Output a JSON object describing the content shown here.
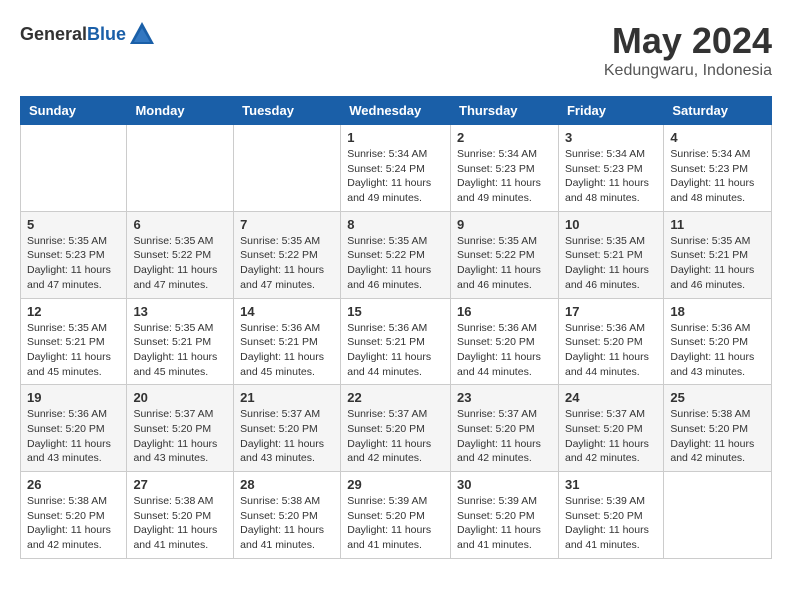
{
  "header": {
    "logo_general": "General",
    "logo_blue": "Blue",
    "title": "May 2024",
    "subtitle": "Kedungwaru, Indonesia"
  },
  "weekdays": [
    "Sunday",
    "Monday",
    "Tuesday",
    "Wednesday",
    "Thursday",
    "Friday",
    "Saturday"
  ],
  "weeks": [
    [
      {
        "day": "",
        "info": ""
      },
      {
        "day": "",
        "info": ""
      },
      {
        "day": "",
        "info": ""
      },
      {
        "day": "1",
        "info": "Sunrise: 5:34 AM\nSunset: 5:24 PM\nDaylight: 11 hours\nand 49 minutes."
      },
      {
        "day": "2",
        "info": "Sunrise: 5:34 AM\nSunset: 5:23 PM\nDaylight: 11 hours\nand 49 minutes."
      },
      {
        "day": "3",
        "info": "Sunrise: 5:34 AM\nSunset: 5:23 PM\nDaylight: 11 hours\nand 48 minutes."
      },
      {
        "day": "4",
        "info": "Sunrise: 5:34 AM\nSunset: 5:23 PM\nDaylight: 11 hours\nand 48 minutes."
      }
    ],
    [
      {
        "day": "5",
        "info": "Sunrise: 5:35 AM\nSunset: 5:23 PM\nDaylight: 11 hours\nand 47 minutes."
      },
      {
        "day": "6",
        "info": "Sunrise: 5:35 AM\nSunset: 5:22 PM\nDaylight: 11 hours\nand 47 minutes."
      },
      {
        "day": "7",
        "info": "Sunrise: 5:35 AM\nSunset: 5:22 PM\nDaylight: 11 hours\nand 47 minutes."
      },
      {
        "day": "8",
        "info": "Sunrise: 5:35 AM\nSunset: 5:22 PM\nDaylight: 11 hours\nand 46 minutes."
      },
      {
        "day": "9",
        "info": "Sunrise: 5:35 AM\nSunset: 5:22 PM\nDaylight: 11 hours\nand 46 minutes."
      },
      {
        "day": "10",
        "info": "Sunrise: 5:35 AM\nSunset: 5:21 PM\nDaylight: 11 hours\nand 46 minutes."
      },
      {
        "day": "11",
        "info": "Sunrise: 5:35 AM\nSunset: 5:21 PM\nDaylight: 11 hours\nand 46 minutes."
      }
    ],
    [
      {
        "day": "12",
        "info": "Sunrise: 5:35 AM\nSunset: 5:21 PM\nDaylight: 11 hours\nand 45 minutes."
      },
      {
        "day": "13",
        "info": "Sunrise: 5:35 AM\nSunset: 5:21 PM\nDaylight: 11 hours\nand 45 minutes."
      },
      {
        "day": "14",
        "info": "Sunrise: 5:36 AM\nSunset: 5:21 PM\nDaylight: 11 hours\nand 45 minutes."
      },
      {
        "day": "15",
        "info": "Sunrise: 5:36 AM\nSunset: 5:21 PM\nDaylight: 11 hours\nand 44 minutes."
      },
      {
        "day": "16",
        "info": "Sunrise: 5:36 AM\nSunset: 5:20 PM\nDaylight: 11 hours\nand 44 minutes."
      },
      {
        "day": "17",
        "info": "Sunrise: 5:36 AM\nSunset: 5:20 PM\nDaylight: 11 hours\nand 44 minutes."
      },
      {
        "day": "18",
        "info": "Sunrise: 5:36 AM\nSunset: 5:20 PM\nDaylight: 11 hours\nand 43 minutes."
      }
    ],
    [
      {
        "day": "19",
        "info": "Sunrise: 5:36 AM\nSunset: 5:20 PM\nDaylight: 11 hours\nand 43 minutes."
      },
      {
        "day": "20",
        "info": "Sunrise: 5:37 AM\nSunset: 5:20 PM\nDaylight: 11 hours\nand 43 minutes."
      },
      {
        "day": "21",
        "info": "Sunrise: 5:37 AM\nSunset: 5:20 PM\nDaylight: 11 hours\nand 43 minutes."
      },
      {
        "day": "22",
        "info": "Sunrise: 5:37 AM\nSunset: 5:20 PM\nDaylight: 11 hours\nand 42 minutes."
      },
      {
        "day": "23",
        "info": "Sunrise: 5:37 AM\nSunset: 5:20 PM\nDaylight: 11 hours\nand 42 minutes."
      },
      {
        "day": "24",
        "info": "Sunrise: 5:37 AM\nSunset: 5:20 PM\nDaylight: 11 hours\nand 42 minutes."
      },
      {
        "day": "25",
        "info": "Sunrise: 5:38 AM\nSunset: 5:20 PM\nDaylight: 11 hours\nand 42 minutes."
      }
    ],
    [
      {
        "day": "26",
        "info": "Sunrise: 5:38 AM\nSunset: 5:20 PM\nDaylight: 11 hours\nand 42 minutes."
      },
      {
        "day": "27",
        "info": "Sunrise: 5:38 AM\nSunset: 5:20 PM\nDaylight: 11 hours\nand 41 minutes."
      },
      {
        "day": "28",
        "info": "Sunrise: 5:38 AM\nSunset: 5:20 PM\nDaylight: 11 hours\nand 41 minutes."
      },
      {
        "day": "29",
        "info": "Sunrise: 5:39 AM\nSunset: 5:20 PM\nDaylight: 11 hours\nand 41 minutes."
      },
      {
        "day": "30",
        "info": "Sunrise: 5:39 AM\nSunset: 5:20 PM\nDaylight: 11 hours\nand 41 minutes."
      },
      {
        "day": "31",
        "info": "Sunrise: 5:39 AM\nSunset: 5:20 PM\nDaylight: 11 hours\nand 41 minutes."
      },
      {
        "day": "",
        "info": ""
      }
    ]
  ]
}
